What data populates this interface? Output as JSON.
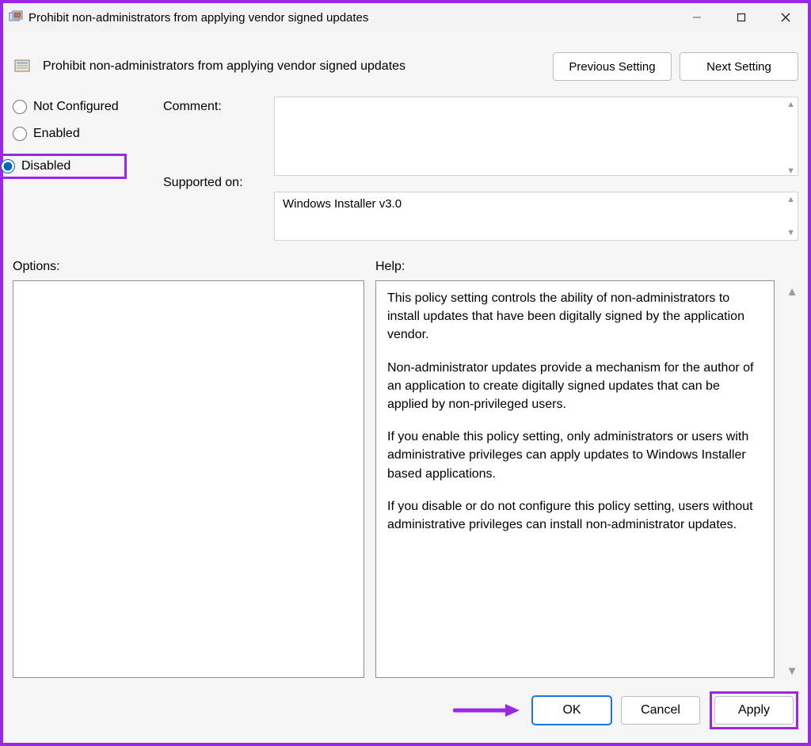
{
  "window": {
    "title": "Prohibit non-administrators from applying vendor signed updates"
  },
  "header": {
    "policy_title": "Prohibit non-administrators from applying vendor signed updates",
    "previous": "Previous Setting",
    "next": "Next Setting"
  },
  "config": {
    "comment_label": "Comment:",
    "supported_label": "Supported on:",
    "supported_value": "Windows Installer v3.0",
    "comment_value": "",
    "radios": {
      "not_configured": "Not Configured",
      "enabled": "Enabled",
      "disabled": "Disabled",
      "selected": "disabled"
    }
  },
  "panes": {
    "options_label": "Options:",
    "help_label": "Help:",
    "help_paragraphs": [
      "This policy setting controls the ability of non-administrators to install updates that have been digitally signed by the application vendor.",
      "Non-administrator updates provide a mechanism for the author of an application to create digitally signed updates that can be applied by non-privileged users.",
      "If you enable this policy setting, only administrators or users with administrative privileges can apply updates to Windows Installer based applications.",
      "If you disable or do not configure this policy setting, users without administrative privileges can install non-administrator updates."
    ]
  },
  "footer": {
    "ok": "OK",
    "cancel": "Cancel",
    "apply": "Apply"
  }
}
